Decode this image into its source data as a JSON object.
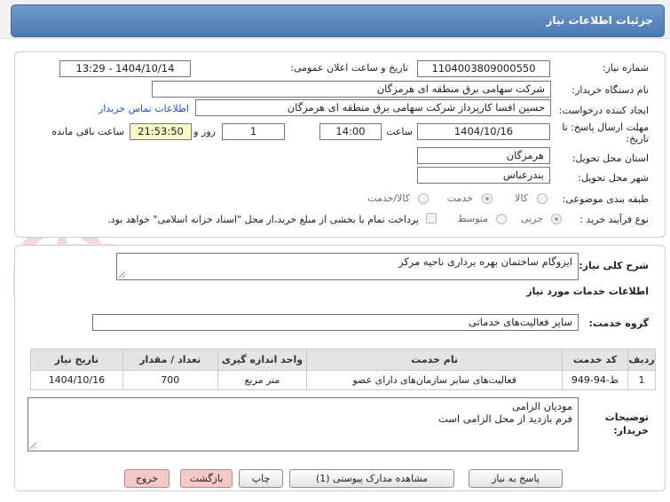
{
  "header": {
    "title": "جزئیات اطلاعات نیاز"
  },
  "form": {
    "need_number_label": "شماره نیاز:",
    "need_number": "1104003809000550",
    "announce_label": "تاریخ و ساعت اعلان عمومی:",
    "announce_value": "1404/10/14 - 13:29",
    "buyer_label": "نام دستگاه خریدار:",
    "buyer_value": "شرکت سهامی برق منطقه ای هرمزگان",
    "creator_label": "ایجاد کننده درخواست:",
    "creator_value": "حسین افسا کارپرداز شرکت سهامی برق منطقه ای هرمزگان",
    "contact_link": "اطلاعات تماس خریدار",
    "deadline_label_line1": "مهلت ارسال پاسخ: تا",
    "deadline_label_line2": "تاریخ:",
    "deadline_date": "1404/10/16",
    "time_label": "ساعت",
    "deadline_time": "14:00",
    "days_value": "1",
    "days_label": "روز و",
    "remaining_time": "21:53:50",
    "remaining_label": "ساعت باقی مانده",
    "province_label": "استان محل تحویل:",
    "province_value": "هرمزگان",
    "city_label": "شهر محل تحویل:",
    "city_value": "بندرعباس",
    "category_label": "طبقه بندی موضوعی:",
    "category_options": [
      "کالا",
      "خدمت",
      "کالا/خدمت"
    ],
    "process_label": "نوع فرآیند خرید :",
    "process_options": [
      "جزیی",
      "متوسط"
    ],
    "payment_note": "پرداخت تمام یا بخشی از مبلغ خرید،از محل \"اسناد خزانه اسلامی\" خواهد بود."
  },
  "summary": {
    "label": "شرح کلی نیاز:",
    "value": "ایزوگام ساختمان بهره برداری ناحیه مرکز"
  },
  "services": {
    "section_title": "اطلاعات خدمات مورد نیاز",
    "group_label": "گروه خدمت:",
    "group_value": "سایر فعالیت‌های خدماتی",
    "columns": [
      "ردیف",
      "کد خدمت",
      "نام خدمت",
      "واحد اندازه گیری",
      "تعداد / مقدار",
      "تاریخ نیاز"
    ],
    "rows": [
      [
        "1",
        "ط-94-949",
        "فعالیت‌های سایر سازمان‌های دارای عضو",
        "متر مربع",
        "700",
        "1404/10/16"
      ]
    ]
  },
  "notes": {
    "label_line1": "توضیحات",
    "label_line2": "خریدار:",
    "line1": "مودیان الزامی",
    "line2": "فرم بازدید از محل الزامی است"
  },
  "buttons": {
    "reply": "پاسخ به نیاز",
    "attachments": "مشاهده مدارک پیوستی (1)",
    "print": "چاپ",
    "back": "بازگشت",
    "exit": "خروج"
  },
  "watermark": {
    "text": "AriaTender.neT"
  },
  "colors": {
    "title_bar": "#4b79b3",
    "link": "#2255cc",
    "remaining_bg": "#fbfbc6",
    "pink_button": "#f6c9c9"
  }
}
